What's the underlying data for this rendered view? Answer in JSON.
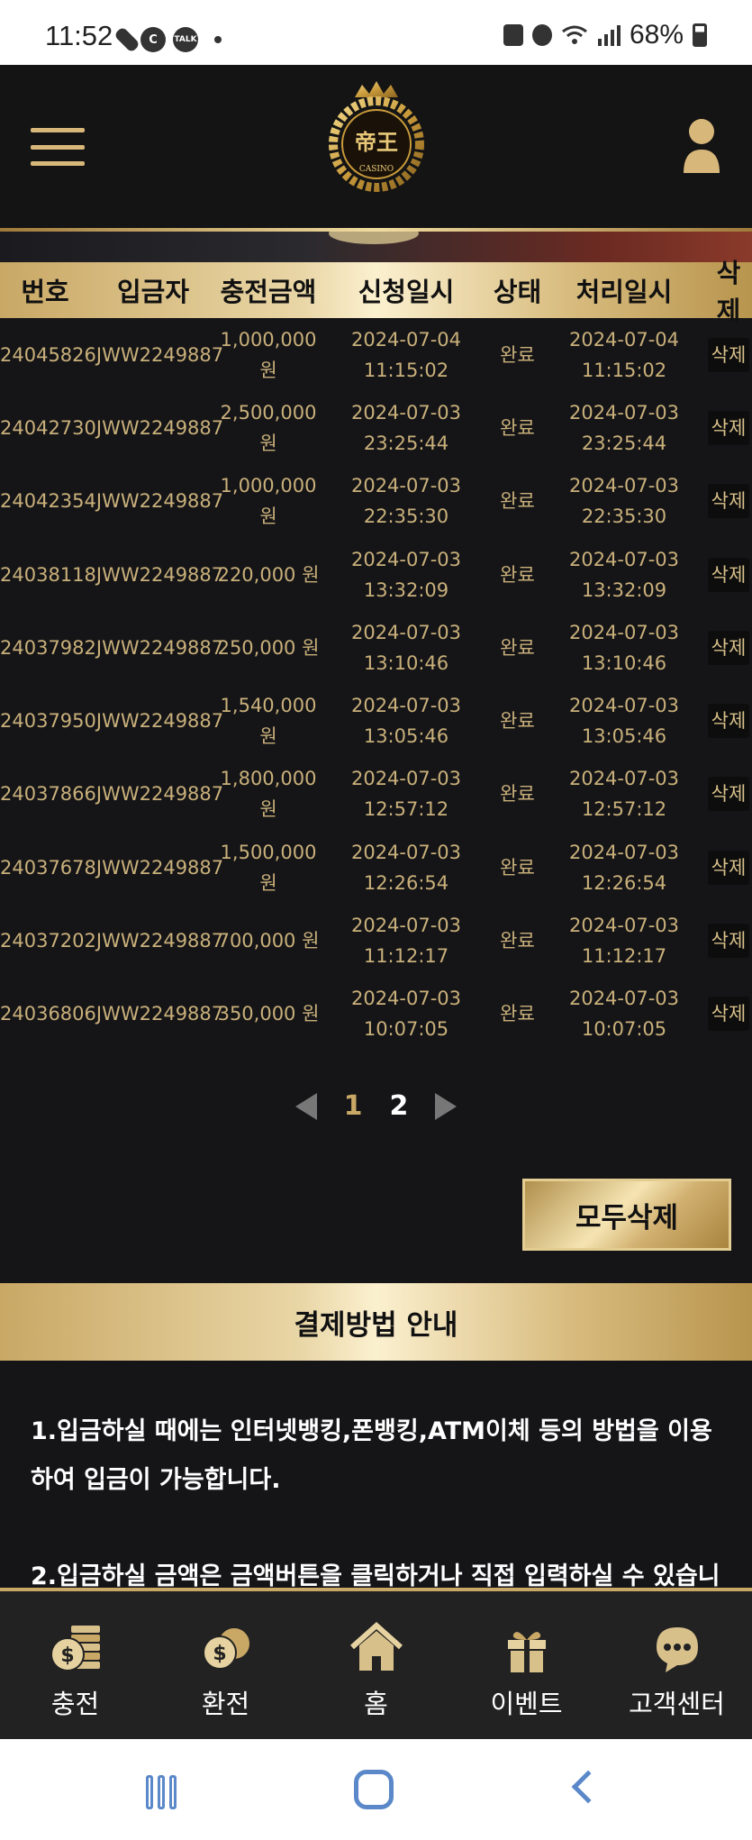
{
  "status_bar": {
    "time": "11:52",
    "chat_badge": "TALK",
    "c_badge": "C",
    "battery": "68%"
  },
  "header": {
    "logo_text": "帝王",
    "logo_subtext": "CASINO"
  },
  "table": {
    "columns": [
      "번호",
      "입금자",
      "충전금액",
      "신청일시",
      "상태",
      "처리일시",
      "삭제"
    ],
    "rows": [
      {
        "id": "24045826JWW2249887",
        "amount_line1": "1,000,000",
        "amount_line2": "원",
        "req_date": "2024-07-04",
        "req_time": "11:15:02",
        "status": "완료",
        "proc_date": "2024-07-04",
        "proc_time": "11:15:02",
        "delete": "삭제"
      },
      {
        "id": "24042730JWW2249887",
        "amount_line1": "2,500,000",
        "amount_line2": "원",
        "req_date": "2024-07-03",
        "req_time": "23:25:44",
        "status": "완료",
        "proc_date": "2024-07-03",
        "proc_time": "23:25:44",
        "delete": "삭제"
      },
      {
        "id": "24042354JWW2249887",
        "amount_line1": "1,000,000",
        "amount_line2": "원",
        "req_date": "2024-07-03",
        "req_time": "22:35:30",
        "status": "완료",
        "proc_date": "2024-07-03",
        "proc_time": "22:35:30",
        "delete": "삭제"
      },
      {
        "id": "24038118JWW2249887",
        "amount_line1": "220,000 원",
        "amount_line2": "",
        "req_date": "2024-07-03",
        "req_time": "13:32:09",
        "status": "완료",
        "proc_date": "2024-07-03",
        "proc_time": "13:32:09",
        "delete": "삭제"
      },
      {
        "id": "24037982JWW2249887",
        "amount_line1": "250,000 원",
        "amount_line2": "",
        "req_date": "2024-07-03",
        "req_time": "13:10:46",
        "status": "완료",
        "proc_date": "2024-07-03",
        "proc_time": "13:10:46",
        "delete": "삭제"
      },
      {
        "id": "24037950JWW2249887",
        "amount_line1": "1,540,000",
        "amount_line2": "원",
        "req_date": "2024-07-03",
        "req_time": "13:05:46",
        "status": "완료",
        "proc_date": "2024-07-03",
        "proc_time": "13:05:46",
        "delete": "삭제"
      },
      {
        "id": "24037866JWW2249887",
        "amount_line1": "1,800,000",
        "amount_line2": "원",
        "req_date": "2024-07-03",
        "req_time": "12:57:12",
        "status": "완료",
        "proc_date": "2024-07-03",
        "proc_time": "12:57:12",
        "delete": "삭제"
      },
      {
        "id": "24037678JWW2249887",
        "amount_line1": "1,500,000",
        "amount_line2": "원",
        "req_date": "2024-07-03",
        "req_time": "12:26:54",
        "status": "완료",
        "proc_date": "2024-07-03",
        "proc_time": "12:26:54",
        "delete": "삭제"
      },
      {
        "id": "24037202JWW2249887",
        "amount_line1": "700,000 원",
        "amount_line2": "",
        "req_date": "2024-07-03",
        "req_time": "11:12:17",
        "status": "완료",
        "proc_date": "2024-07-03",
        "proc_time": "11:12:17",
        "delete": "삭제"
      },
      {
        "id": "24036806JWW2249887",
        "amount_line1": "350,000 원",
        "amount_line2": "",
        "req_date": "2024-07-03",
        "req_time": "10:07:05",
        "status": "완료",
        "proc_date": "2024-07-03",
        "proc_time": "10:07:05",
        "delete": "삭제"
      }
    ]
  },
  "pagination": {
    "pages": [
      "1",
      "2"
    ],
    "current": "2"
  },
  "actions": {
    "delete_all": "모두삭제"
  },
  "guide": {
    "title": "결제방법 안내",
    "line1": "1.입금하실 때에는 인터넷뱅킹,폰뱅킹,ATM이체 등의 방법을 이용하여 입금이 가능합니다.",
    "line2": "2.입금하실 금액은 금액버튼을 클릭하거나 직접 입력하실 수 있습니"
  },
  "bottom_nav": [
    {
      "label": "충전",
      "icon": "coin-stack-icon"
    },
    {
      "label": "환전",
      "icon": "coins-icon"
    },
    {
      "label": "홈",
      "icon": "home-icon"
    },
    {
      "label": "이벤트",
      "icon": "gift-icon"
    },
    {
      "label": "고객센터",
      "icon": "support-chat-icon"
    }
  ],
  "colors": {
    "gold": "#c9a865",
    "background": "#151518",
    "row_text": "#c9b07a"
  }
}
